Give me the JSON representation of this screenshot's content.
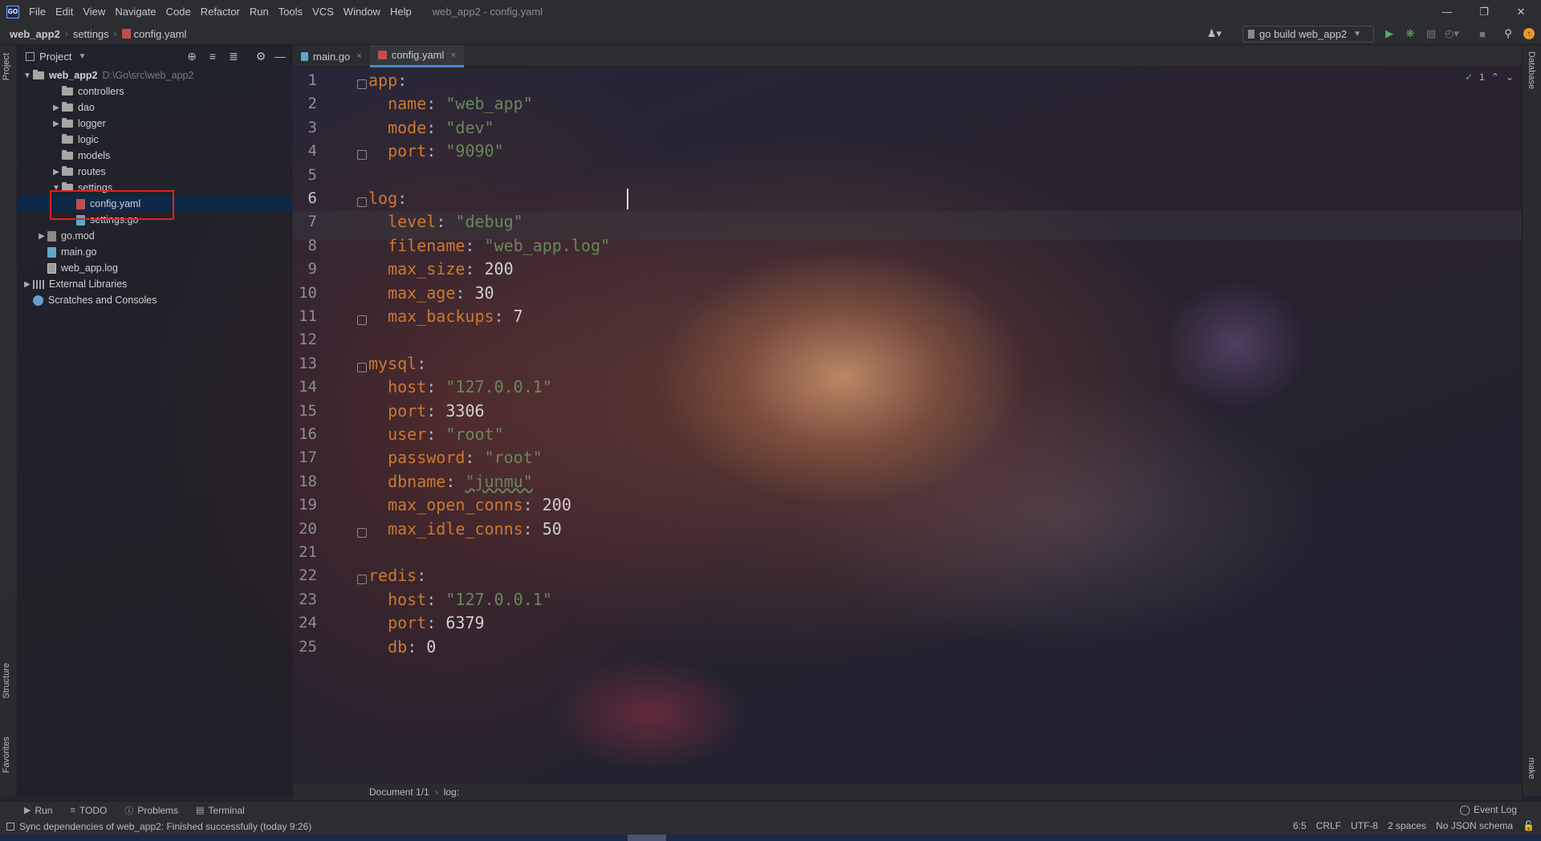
{
  "window": {
    "title": "web_app2 - config.yaml",
    "logo": "GO",
    "menu": [
      "File",
      "Edit",
      "View",
      "Navigate",
      "Code",
      "Refactor",
      "Run",
      "Tools",
      "VCS",
      "Window",
      "Help"
    ],
    "controls": [
      "minimize-icon",
      "restore-icon",
      "close-icon"
    ]
  },
  "navbar": {
    "breadcrumbs": [
      "web_app2",
      "settings",
      "config.yaml"
    ],
    "run_config": "go build web_app2",
    "icons": [
      "user-icon",
      "run-icon",
      "debug-icon",
      "coverage-icon",
      "profile-icon",
      "stop-icon",
      "search-icon",
      "update-icon"
    ]
  },
  "left_strip": {
    "project": "Project",
    "structure": "Structure",
    "favorites": "Favorites"
  },
  "right_strip": {
    "database": "Database",
    "make": "make"
  },
  "project": {
    "header": "Project",
    "root": {
      "name": "web_app2",
      "path": "D:\\Go\\src\\web_app2"
    },
    "items": [
      {
        "name": "controllers",
        "type": "folder",
        "arrow": ""
      },
      {
        "name": "dao",
        "type": "folder",
        "arrow": "▶"
      },
      {
        "name": "logger",
        "type": "folder",
        "arrow": "▶"
      },
      {
        "name": "logic",
        "type": "folder",
        "arrow": ""
      },
      {
        "name": "models",
        "type": "folder",
        "arrow": ""
      },
      {
        "name": "routes",
        "type": "folder",
        "arrow": "▶"
      },
      {
        "name": "settings",
        "type": "folder",
        "arrow": "▼"
      },
      {
        "name": "config.yaml",
        "type": "yaml",
        "arrow": ""
      },
      {
        "name": "settings.go",
        "type": "go",
        "arrow": ""
      },
      {
        "name": "go.mod",
        "type": "mod",
        "arrow": "▶"
      },
      {
        "name": "main.go",
        "type": "go",
        "arrow": ""
      },
      {
        "name": "web_app.log",
        "type": "log",
        "arrow": ""
      },
      {
        "name": "External Libraries",
        "type": "lib",
        "arrow": "▶"
      },
      {
        "name": "Scratches and Consoles",
        "type": "scratch",
        "arrow": ""
      }
    ]
  },
  "tabs": [
    {
      "label": "main.go",
      "close": "×"
    },
    {
      "label": "config.yaml",
      "close": "×"
    }
  ],
  "editor": {
    "inspection": {
      "count": "1"
    },
    "lines": [
      {
        "n": "1",
        "key": "app",
        "val": ""
      },
      {
        "n": "2",
        "key": "name",
        "val": "\"web_app\""
      },
      {
        "n": "3",
        "key": "mode",
        "val": "\"dev\""
      },
      {
        "n": "4",
        "key": "port",
        "val": "\"9090\""
      },
      {
        "n": "5",
        "key": "",
        "val": ""
      },
      {
        "n": "6",
        "key": "log",
        "val": ""
      },
      {
        "n": "7",
        "key": "level",
        "val": "\"debug\""
      },
      {
        "n": "8",
        "key": "filename",
        "val": "\"web_app.log\""
      },
      {
        "n": "9",
        "key": "max_size",
        "val": "200"
      },
      {
        "n": "10",
        "key": "max_age",
        "val": "30"
      },
      {
        "n": "11",
        "key": "max_backups",
        "val": "7"
      },
      {
        "n": "12",
        "key": "",
        "val": ""
      },
      {
        "n": "13",
        "key": "mysql",
        "val": ""
      },
      {
        "n": "14",
        "key": "host",
        "val": "\"127.0.0.1\""
      },
      {
        "n": "15",
        "key": "port",
        "val": "3306"
      },
      {
        "n": "16",
        "key": "user",
        "val": "\"root\""
      },
      {
        "n": "17",
        "key": "password",
        "val": "\"root\""
      },
      {
        "n": "18",
        "key": "dbname",
        "val": "\"junmu\""
      },
      {
        "n": "19",
        "key": "max_open_conns",
        "val": "200"
      },
      {
        "n": "20",
        "key": "max_idle_conns",
        "val": "50"
      },
      {
        "n": "21",
        "key": "",
        "val": ""
      },
      {
        "n": "22",
        "key": "redis",
        "val": ""
      },
      {
        "n": "23",
        "key": "host",
        "val": "\"127.0.0.1\""
      },
      {
        "n": "24",
        "key": "port",
        "val": "6379"
      },
      {
        "n": "25",
        "key": "db",
        "val": "0"
      }
    ]
  },
  "editor_breadcrumb": [
    "Document 1/1",
    "log:"
  ],
  "bottom_tools": [
    "Run",
    "TODO",
    "Problems",
    "Terminal"
  ],
  "event_log": "Event Log",
  "status": {
    "message": "Sync dependencies of web_app2: Finished successfully (today 9:26)",
    "position": "6:5",
    "line_ending": "CRLF",
    "encoding": "UTF-8",
    "indent": "2 spaces",
    "schema": "No JSON schema"
  },
  "colors": {
    "key": "#cc7832",
    "string": "#6a8759",
    "number": "#d0d0d0",
    "accent": "#4a88c7",
    "highlight_box": "#e02020"
  }
}
